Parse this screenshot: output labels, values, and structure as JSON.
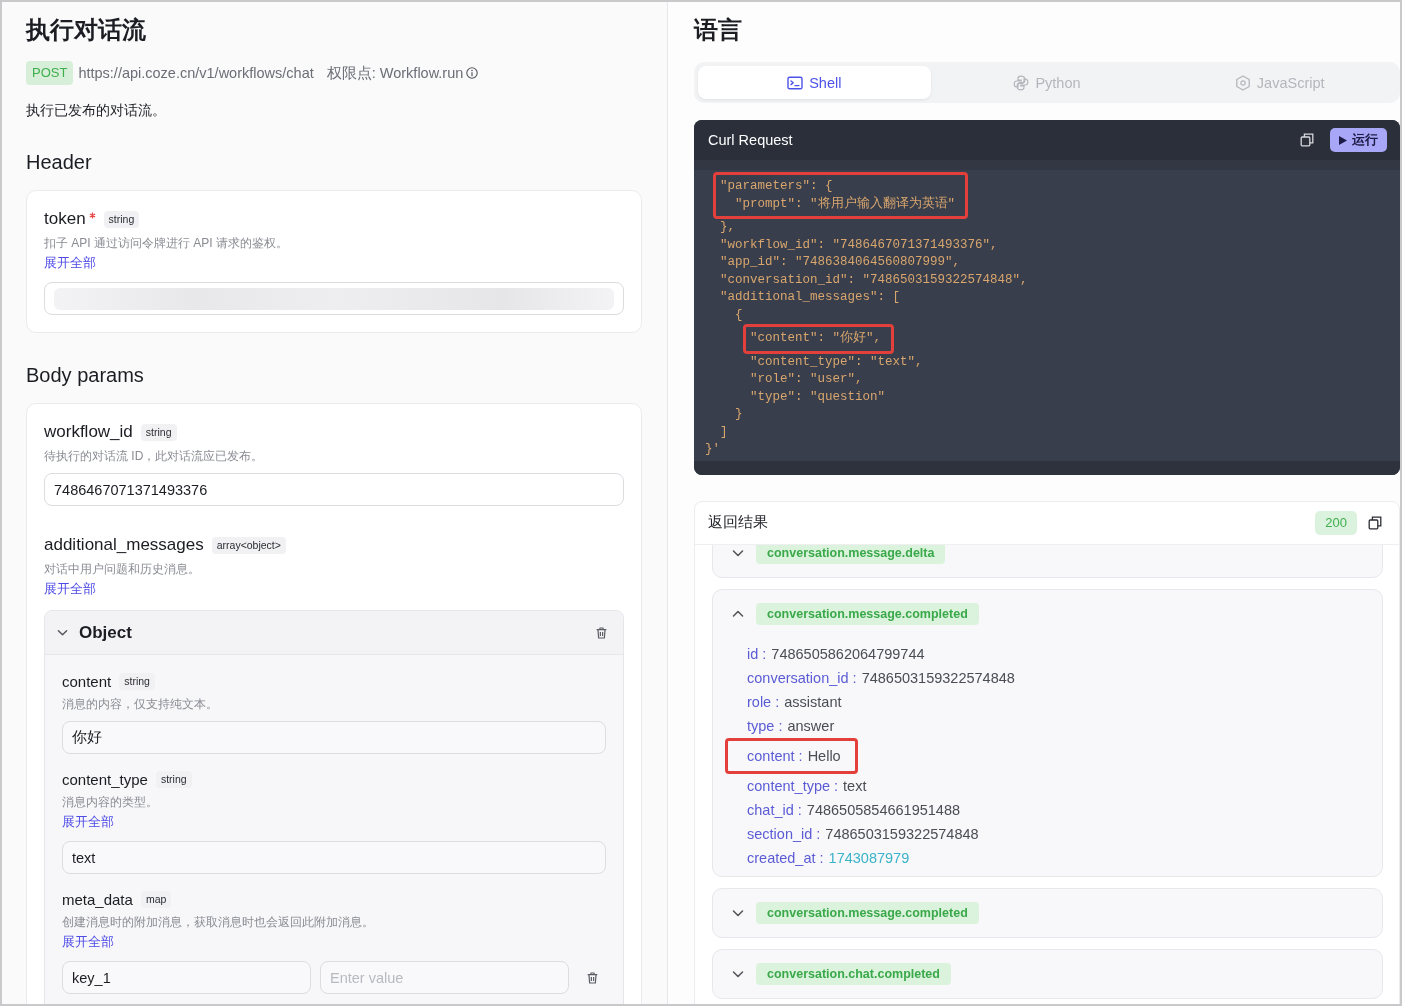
{
  "api": {
    "title": "执行对话流",
    "method": "POST",
    "url": "https://api.coze.cn/v1/workflows/chat",
    "permission": "权限点: Workflow.run",
    "description": "执行已发布的对话流。",
    "sections": [
      {
        "heading": "Header",
        "params": [
          {
            "name": "token",
            "required": true,
            "type": "string",
            "description": "扣子 API 通过访问令牌进行 API 请求的鉴权。",
            "expand_link": "展开全部",
            "field": {
              "kind": "redacted"
            }
          }
        ]
      },
      {
        "heading": "Body params",
        "params": [
          {
            "name": "workflow_id",
            "required": false,
            "type": "string",
            "description": "待执行的对话流 ID，此对话流应已发布。",
            "field": {
              "kind": "text",
              "value": "7486467071371493376"
            }
          },
          {
            "name": "additional_messages",
            "required": false,
            "type": "array<object>",
            "description": "对话中用户问题和历史消息。",
            "expand_link": "展开全部",
            "object": {
              "title": "Object",
              "expanded": true,
              "params": [
                {
                  "name": "content",
                  "required": false,
                  "type": "string",
                  "description": "消息的内容，仅支持纯文本。",
                  "field": {
                    "kind": "text",
                    "value": "你好"
                  }
                },
                {
                  "name": "content_type",
                  "required": false,
                  "type": "string",
                  "description": "消息内容的类型。",
                  "expand_link": "展开全部",
                  "field": {
                    "kind": "text",
                    "value": "text"
                  }
                },
                {
                  "name": "meta_data",
                  "required": false,
                  "type": "map",
                  "description": "创建消息时的附加消息，获取消息时也会返回此附加消息。",
                  "expand_link": "展开全部",
                  "field": {
                    "kind": "key_value",
                    "key": "key_1",
                    "placeholder": "Enter value"
                  }
                }
              ]
            }
          }
        ]
      }
    ]
  },
  "language": {
    "title": "语言",
    "tabs": [
      {
        "label": "Shell",
        "selected": true
      },
      {
        "label": "Python",
        "selected": false
      },
      {
        "label": "JavaScript",
        "selected": false
      }
    ],
    "request": {
      "title": "Curl Request",
      "run_button": "运行",
      "segments": [
        {
          "highlighted": true,
          "lines": [
            "  \"parameters\": {",
            "    \"prompt\": \"将用户输入翻译为英语\""
          ]
        },
        {
          "highlighted": false,
          "lines": [
            "  },",
            "  \"workflow_id\": \"7486467071371493376\",",
            "  \"app_id\": \"7486384064560807999\",",
            "  \"conversation_id\": \"7486503159322574848\",",
            "  \"additional_messages\": [",
            "    {"
          ]
        },
        {
          "highlighted": true,
          "lines": [
            "      \"content\": \"你好\","
          ]
        },
        {
          "highlighted": false,
          "lines": [
            "      \"content_type\": \"text\",",
            "      \"role\": \"user\",",
            "      \"type\": \"question\"",
            "    }",
            "  ]",
            "}'"
          ]
        }
      ]
    },
    "response": {
      "title": "返回结果",
      "status": "200",
      "events": [
        {
          "name": "conversation.message.delta",
          "expanded": false
        },
        {
          "name": "conversation.message.completed",
          "expanded": true,
          "fields": [
            {
              "key": "id :",
              "value": "7486505862064799744",
              "kind": "string",
              "highlighted": false
            },
            {
              "key": "conversation_id :",
              "value": "7486503159322574848",
              "kind": "string",
              "highlighted": false
            },
            {
              "key": "role :",
              "value": "assistant",
              "kind": "string",
              "highlighted": false
            },
            {
              "key": "type :",
              "value": "answer",
              "kind": "string",
              "highlighted": false
            },
            {
              "key": "content :",
              "value": "Hello",
              "kind": "string",
              "highlighted": true
            },
            {
              "key": "content_type :",
              "value": "text",
              "kind": "string",
              "highlighted": false
            },
            {
              "key": "chat_id :",
              "value": "7486505854661951488",
              "kind": "string",
              "highlighted": false
            },
            {
              "key": "section_id :",
              "value": "7486503159322574848",
              "kind": "string",
              "highlighted": false
            },
            {
              "key": "created_at :",
              "value": "1743087979",
              "kind": "number",
              "highlighted": false
            }
          ]
        },
        {
          "name": "conversation.message.completed",
          "expanded": false
        },
        {
          "name": "conversation.chat.completed",
          "expanded": false
        }
      ]
    }
  }
}
